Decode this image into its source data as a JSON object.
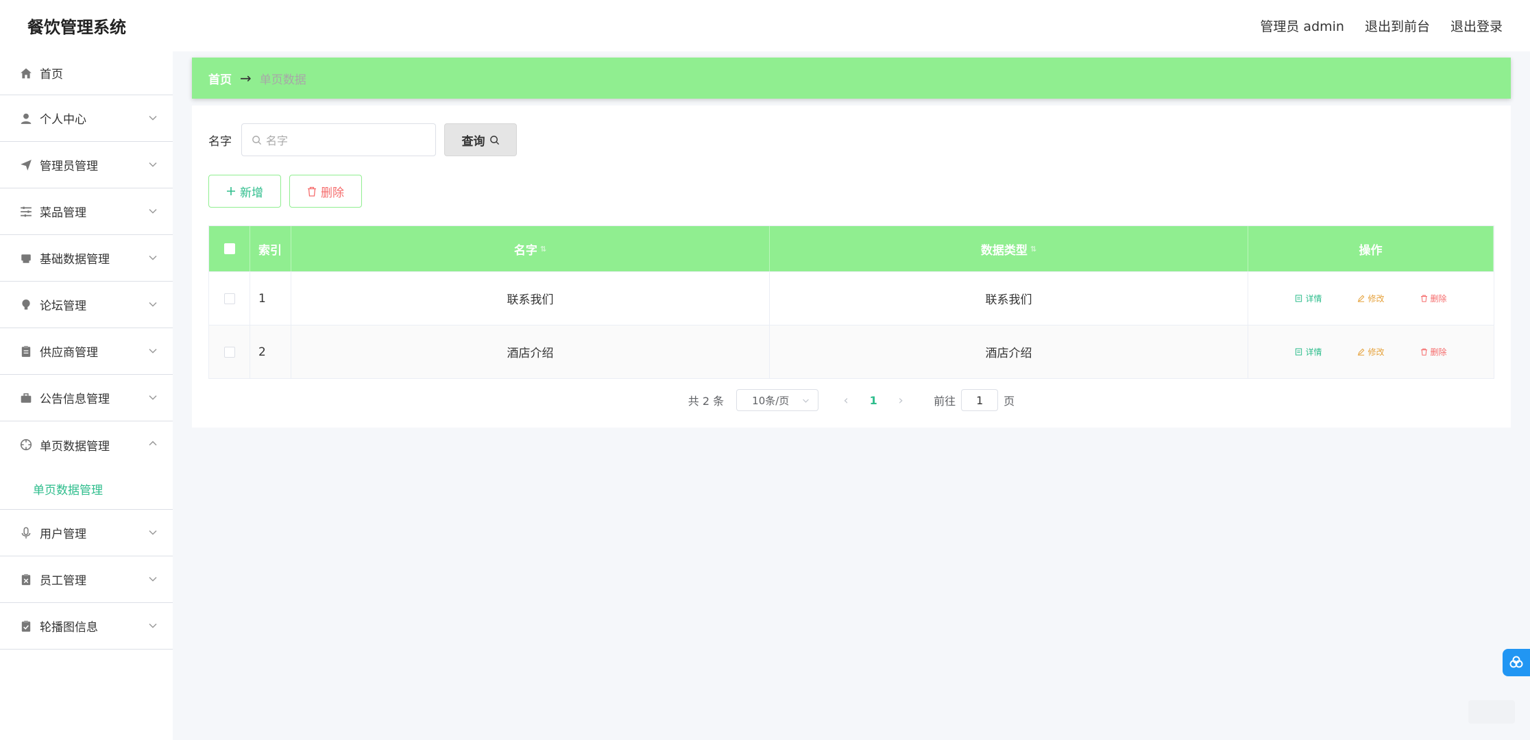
{
  "header": {
    "title": "餐饮管理系统",
    "user_label": "管理员 admin",
    "to_front": "退出到前台",
    "logout": "退出登录"
  },
  "sidebar": {
    "items": [
      {
        "label": "首页",
        "icon": "home-icon"
      },
      {
        "label": "个人中心",
        "icon": "user-icon"
      },
      {
        "label": "管理员管理",
        "icon": "paper-plane-icon"
      },
      {
        "label": "菜品管理",
        "icon": "sliders-icon"
      },
      {
        "label": "基础数据管理",
        "icon": "printer-icon"
      },
      {
        "label": "论坛管理",
        "icon": "lightbulb-icon"
      },
      {
        "label": "供应商管理",
        "icon": "clipboard-icon"
      },
      {
        "label": "公告信息管理",
        "icon": "briefcase-icon"
      },
      {
        "label": "单页数据管理",
        "icon": "crosshair-icon"
      },
      {
        "label": "用户管理",
        "icon": "microphone-icon"
      },
      {
        "label": "员工管理",
        "icon": "clipboard-x-icon"
      },
      {
        "label": "轮播图信息",
        "icon": "clipboard-check-icon"
      }
    ],
    "active_sub": "单页数据管理"
  },
  "breadcrumb": {
    "home": "首页",
    "separator": "→",
    "current": "单页数据"
  },
  "search": {
    "label": "名字",
    "placeholder": "名字",
    "button": "查询"
  },
  "actions": {
    "add": "新增",
    "delete": "删除"
  },
  "table": {
    "columns": [
      "索引",
      "名字",
      "数据类型",
      "操作"
    ],
    "rows": [
      {
        "index": "1",
        "name": "联系我们",
        "type": "联系我们"
      },
      {
        "index": "2",
        "name": "酒店介绍",
        "type": "酒店介绍"
      }
    ],
    "ops": {
      "detail": "详情",
      "edit": "修改",
      "delete": "删除"
    }
  },
  "pagination": {
    "total": "共 2 条",
    "page_size": "10条/页",
    "current_page": "1",
    "goto_prefix": "前往",
    "goto_value": "1",
    "goto_suffix": "页"
  },
  "colors": {
    "accent_green": "#90ee90",
    "link_green": "#2ebd8c",
    "warning": "#e6a23c",
    "danger": "#f56c6c"
  }
}
